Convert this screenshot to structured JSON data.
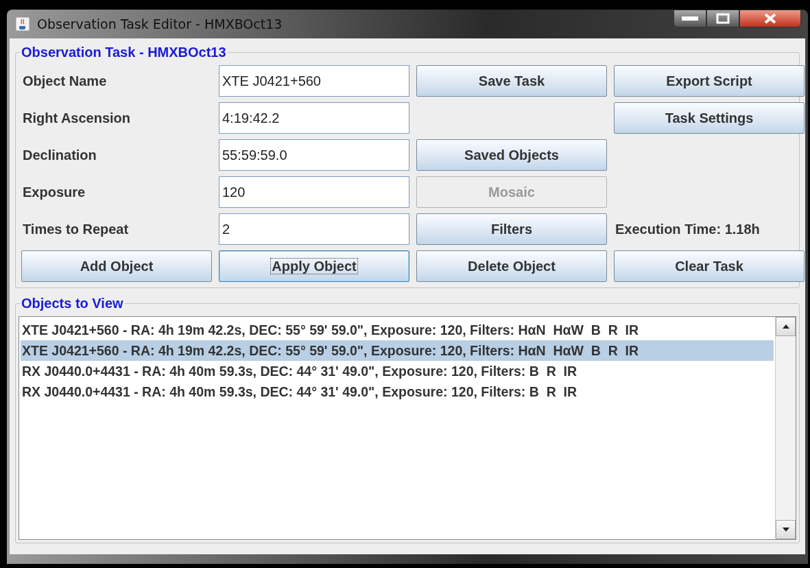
{
  "window": {
    "title": "Observation Task Editor - HMXBOct13"
  },
  "task_panel": {
    "title": "Observation Task - HMXBOct13",
    "cells": [
      {
        "kind": "label",
        "text": "Object Name"
      },
      {
        "kind": "field",
        "value": "XTE J0421+560"
      },
      {
        "kind": "button",
        "label": "Save Task",
        "disabled": false,
        "focused": false
      },
      {
        "kind": "button",
        "label": "Export Script",
        "disabled": false,
        "focused": false
      },
      {
        "kind": "label",
        "text": "Right Ascension"
      },
      {
        "kind": "field",
        "value": "4:19:42.2"
      },
      {
        "kind": "blank"
      },
      {
        "kind": "button",
        "label": "Task Settings",
        "disabled": false,
        "focused": false
      },
      {
        "kind": "label",
        "text": "Declination"
      },
      {
        "kind": "field",
        "value": "55:59:59.0"
      },
      {
        "kind": "button",
        "label": "Saved Objects",
        "disabled": false,
        "focused": false
      },
      {
        "kind": "blank"
      },
      {
        "kind": "label",
        "text": "Exposure"
      },
      {
        "kind": "field",
        "value": "120"
      },
      {
        "kind": "button",
        "label": "Mosaic",
        "disabled": true,
        "focused": false
      },
      {
        "kind": "blank"
      },
      {
        "kind": "label",
        "text": "Times to Repeat"
      },
      {
        "kind": "field",
        "value": "2"
      },
      {
        "kind": "button",
        "label": "Filters",
        "disabled": false,
        "focused": false
      },
      {
        "kind": "label",
        "text": "Execution Time: 1.18h"
      },
      {
        "kind": "button",
        "label": "Add Object",
        "disabled": false,
        "focused": false
      },
      {
        "kind": "button",
        "label": "Apply Object",
        "disabled": false,
        "focused": true
      },
      {
        "kind": "button",
        "label": "Delete Object",
        "disabled": false,
        "focused": false
      },
      {
        "kind": "button",
        "label": "Clear Task",
        "disabled": false,
        "focused": false
      }
    ]
  },
  "objects_panel": {
    "title": "Objects to View",
    "items": [
      {
        "text": "XTE J0421+560 - RA: 4h 19m 42.2s, DEC: 55° 59' 59.0\", Exposure: 120, Filters: HαN  HαW  B  R  IR",
        "selected": false
      },
      {
        "text": "XTE J0421+560 - RA: 4h 19m 42.2s, DEC: 55° 59' 59.0\", Exposure: 120, Filters: HαN  HαW  B  R  IR",
        "selected": true
      },
      {
        "text": "RX J0440.0+4431 - RA: 4h 40m 59.3s, DEC: 44° 31' 49.0\", Exposure: 120, Filters: B  R  IR",
        "selected": false
      },
      {
        "text": "RX J0440.0+4431 - RA: 4h 40m 59.3s, DEC: 44° 31' 49.0\", Exposure: 120, Filters: B  R  IR",
        "selected": false
      }
    ]
  }
}
